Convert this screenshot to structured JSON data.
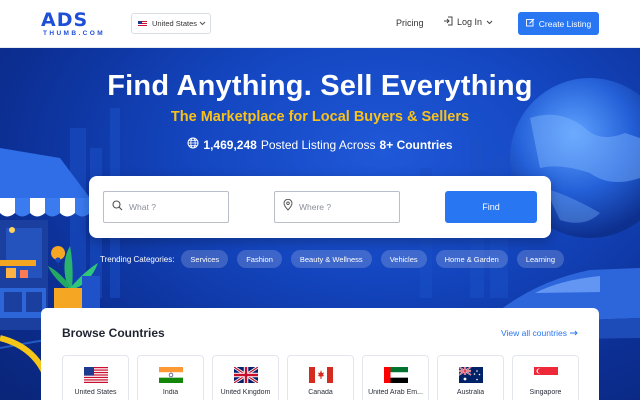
{
  "header": {
    "logo_text": "ADS",
    "logo_subtext": "THUMB.COM",
    "country_selector": "United States",
    "pricing_label": "Pricing",
    "login_label": "Log In",
    "create_listing_label": "Create Listing"
  },
  "hero": {
    "title": "Find Anything. Sell Everything",
    "subtitle": "The Marketplace for Local Buyers & Sellers",
    "stats_count": "1,469,248",
    "stats_text": "Posted Listing Across",
    "stats_countries": "8+ Countries"
  },
  "search": {
    "what_placeholder": "What ?",
    "where_placeholder": "Where ?",
    "find_label": "Find"
  },
  "trending": {
    "label": "Trending Categories:",
    "categories": [
      "Services",
      "Fashion",
      "Beauty & Wellness",
      "Vehicles",
      "Home & Garden",
      "Learning"
    ]
  },
  "browse": {
    "title": "Browse Countries",
    "view_all_label": "View all countries",
    "countries": [
      {
        "name": "United States",
        "flag": "us-flag"
      },
      {
        "name": "India",
        "flag": "india-flag"
      },
      {
        "name": "United Kingdom",
        "flag": "uk-flag"
      },
      {
        "name": "Canada",
        "flag": "canada-flag"
      },
      {
        "name": "United Arab Em...",
        "flag": "uae-flag"
      },
      {
        "name": "Australia",
        "flag": "australia-flag"
      },
      {
        "name": "Singapore",
        "flag": "singapore-flag"
      }
    ]
  },
  "colors": {
    "brand_blue": "#2876f2",
    "accent_yellow": "#f9c21a",
    "hero_dark": "#0c2f94"
  }
}
